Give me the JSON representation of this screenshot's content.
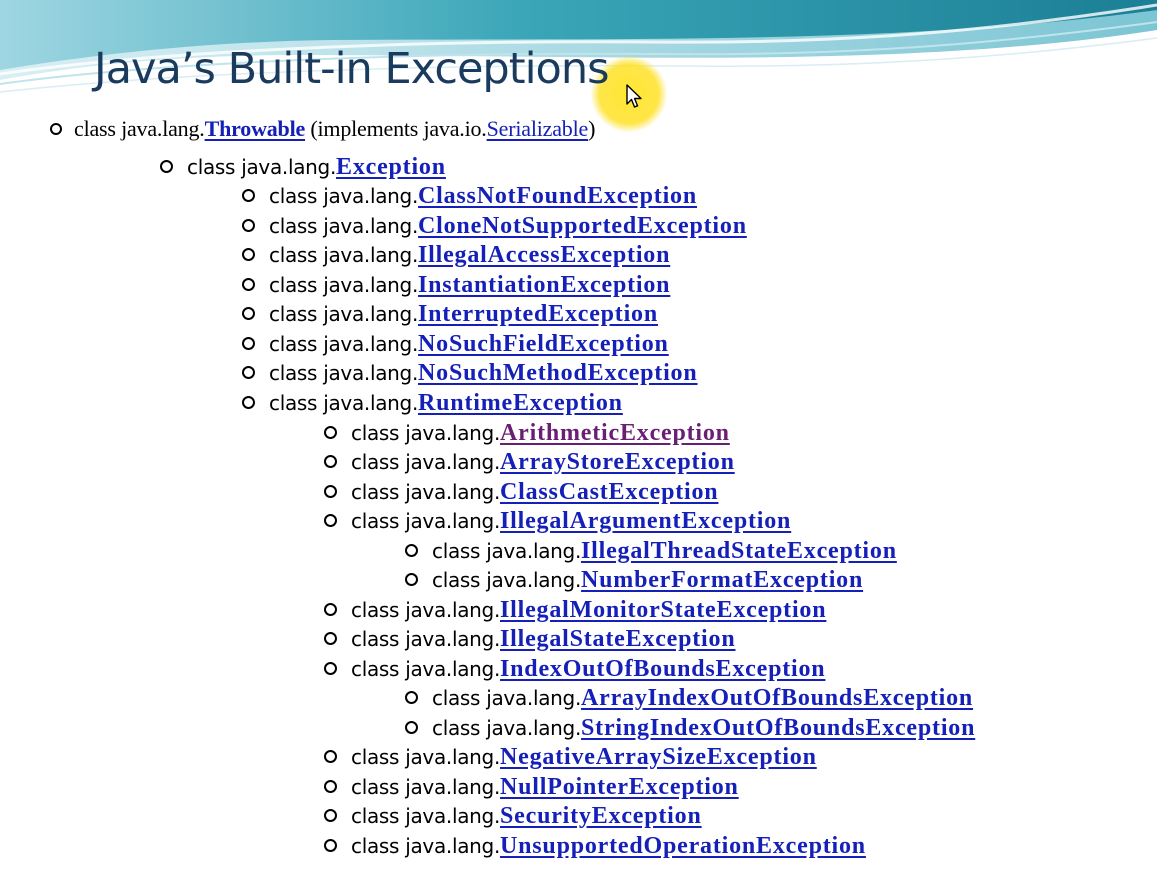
{
  "slide": {
    "title": "Java’s Built-in Exceptions"
  },
  "root": {
    "prefix": "class java.lang.",
    "class_name": "Throwable",
    "implements_prefix": " (implements java.io.",
    "interface_name": "Serializable",
    "implements_suffix": ")"
  },
  "tree": [
    {
      "prefix": "class java.lang.",
      "class_name": "Exception",
      "visited": false
    },
    {
      "prefix": "class java.lang.",
      "class_name": "ClassNotFoundException",
      "visited": false
    },
    {
      "prefix": "class java.lang.",
      "class_name": "CloneNotSupportedException",
      "visited": false
    },
    {
      "prefix": "class java.lang.",
      "class_name": "IllegalAccessException",
      "visited": false
    },
    {
      "prefix": "class java.lang.",
      "class_name": "InstantiationException",
      "visited": false
    },
    {
      "prefix": "class java.lang.",
      "class_name": "InterruptedException",
      "visited": false
    },
    {
      "prefix": "class java.lang.",
      "class_name": "NoSuchFieldException",
      "visited": false
    },
    {
      "prefix": "class java.lang.",
      "class_name": "NoSuchMethodException",
      "visited": false
    },
    {
      "prefix": "class java.lang.",
      "class_name": "RuntimeException",
      "visited": false
    },
    {
      "prefix": "class java.lang.",
      "class_name": "ArithmeticException",
      "visited": true
    },
    {
      "prefix": "class java.lang.",
      "class_name": "ArrayStoreException",
      "visited": false
    },
    {
      "prefix": "class java.lang.",
      "class_name": "ClassCastException",
      "visited": false
    },
    {
      "prefix": "class java.lang.",
      "class_name": "IllegalArgumentException",
      "visited": false
    },
    {
      "prefix": "class java.lang.",
      "class_name": "IllegalThreadStateException",
      "visited": false
    },
    {
      "prefix": "class java.lang.",
      "class_name": "NumberFormatException",
      "visited": false
    },
    {
      "prefix": "class java.lang.",
      "class_name": "IllegalMonitorStateException",
      "visited": false
    },
    {
      "prefix": "class java.lang.",
      "class_name": "IllegalStateException",
      "visited": false
    },
    {
      "prefix": "class java.lang.",
      "class_name": "IndexOutOfBoundsException",
      "visited": false
    },
    {
      "prefix": "class java.lang.",
      "class_name": "ArrayIndexOutOfBoundsException",
      "visited": false
    },
    {
      "prefix": "class java.lang.",
      "class_name": "StringIndexOutOfBoundsException",
      "visited": false
    },
    {
      "prefix": "class java.lang.",
      "class_name": "NegativeArraySizeException",
      "visited": false
    },
    {
      "prefix": "class java.lang.",
      "class_name": "NullPointerException",
      "visited": false
    },
    {
      "prefix": "class java.lang.",
      "class_name": "SecurityException",
      "visited": false
    },
    {
      "prefix": "class java.lang.",
      "class_name": "UnsupportedOperationException",
      "visited": false
    }
  ],
  "colors": {
    "title": "#1a3a5e",
    "link": "#1520b8",
    "visited_link": "#6a1e74",
    "banner_teal": "#3aa6b8",
    "cursor_highlight": "#ffe028"
  },
  "icons": {
    "pointer": "mouse-pointer-icon",
    "bullet": "hollow-circle-bullet-icon"
  }
}
